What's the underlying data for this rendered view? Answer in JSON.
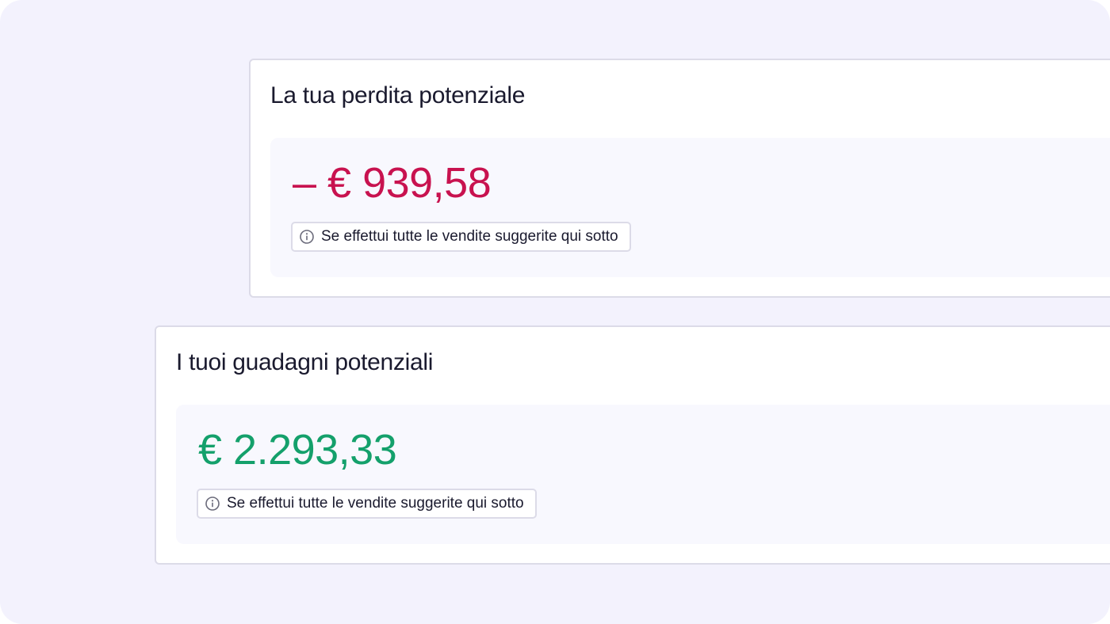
{
  "loss_card": {
    "title": "La tua perdita potenziale",
    "amount": "– € 939,58",
    "note": "Se effettui tutte le vendite suggerite qui sotto"
  },
  "gain_card": {
    "title": "I tuoi guadagni potenziali",
    "amount": "€ 2.293,33",
    "note": "Se effettui tutte le vendite suggerite qui sotto"
  },
  "icons": {
    "note_icon": "info-icon"
  },
  "colors": {
    "background": "#f3f2fd",
    "loss": "#c8124f",
    "gain": "#14a06b",
    "text": "#1a1a2e"
  }
}
